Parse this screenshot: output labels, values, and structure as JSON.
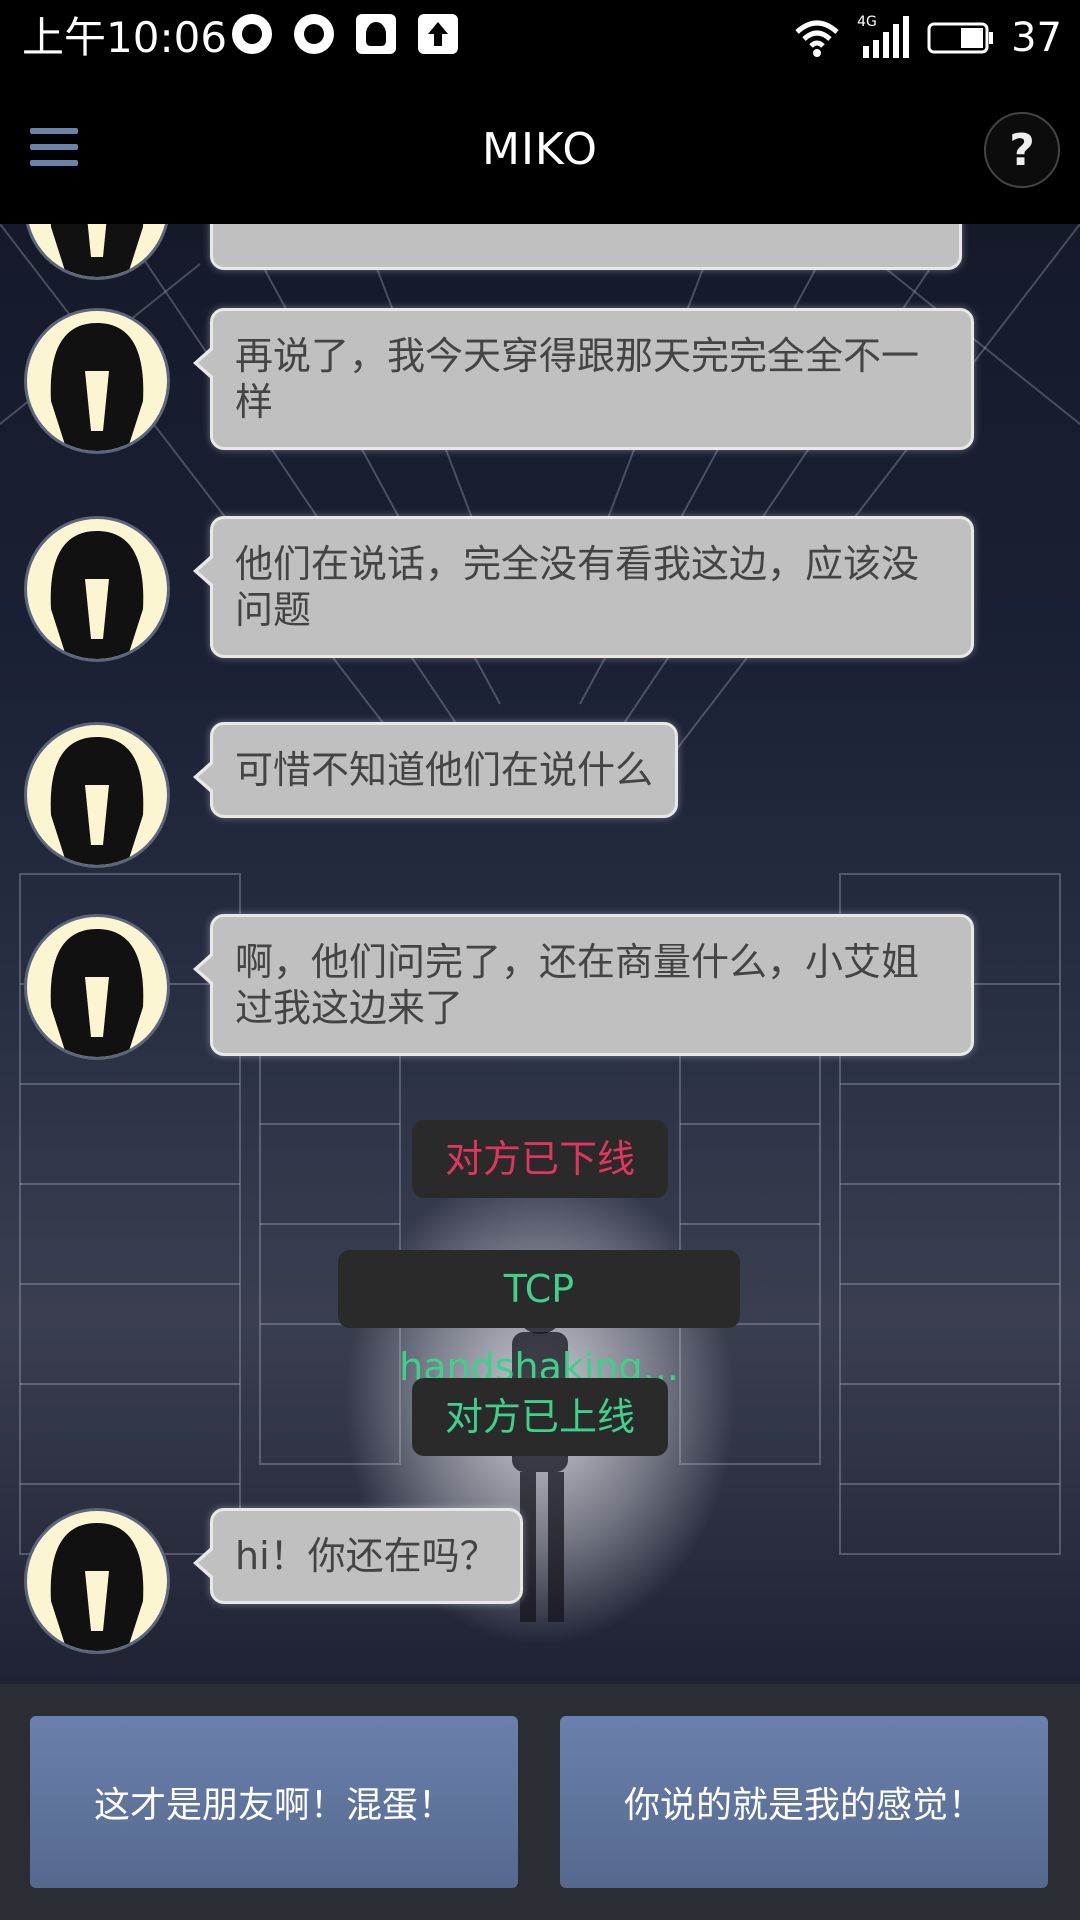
{
  "status_bar": {
    "time": "上午10:06",
    "network": "4G",
    "battery": "37",
    "icons": [
      "sync-icon",
      "sync-icon",
      "qq-icon",
      "upload-icon",
      "wifi-icon",
      "signal-icon",
      "battery-icon"
    ]
  },
  "header": {
    "title": "MIKO",
    "menu_icon": "hamburger-menu-icon",
    "help_label": "?"
  },
  "messages": [
    {
      "text": "再说了，我今天穿得跟那天完完全全不一样"
    },
    {
      "text": "他们在说话，完全没有看我这边，应该没问题"
    },
    {
      "text": "可惜不知道他们在说什么"
    },
    {
      "text": "啊，他们问完了，还在商量什么，小艾姐过我这边来了"
    },
    {
      "text": "hi！你还在吗？"
    }
  ],
  "system_messages": [
    {
      "text": "对方已下线",
      "color": "#e0365e"
    },
    {
      "text": "TCP handshaking...",
      "color": "#3fd08a"
    },
    {
      "text": "对方已上线",
      "color": "#3fd08a"
    }
  ],
  "replies": [
    {
      "label": "这才是朋友啊！混蛋！"
    },
    {
      "label": "你说的就是我的感觉！"
    }
  ]
}
